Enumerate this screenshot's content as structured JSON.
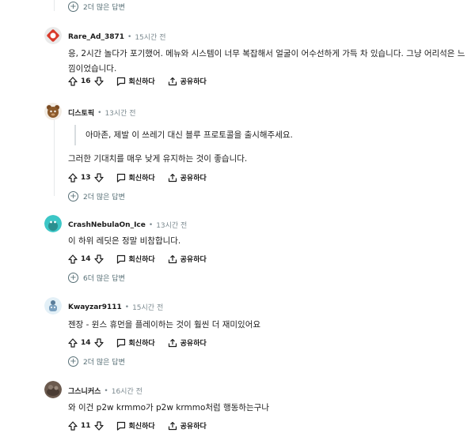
{
  "top_more": {
    "label": "2더 많은 답변"
  },
  "comments": [
    {
      "user": "Rare_Ad_3871",
      "time": "15시간 전",
      "text_lines": [
        "응, 2시간 놀다가 포기했어. 메뉴와 시스템이 너무 복잡해서 얼굴이 어수선하게 가득 차 있습니다. 그냥 어리석은 느",
        "낌이었습니다."
      ],
      "votes": "16",
      "reply_label": "회신하다",
      "share_label": "공유하다"
    },
    {
      "user": "디스토픽",
      "time": "13시간 전",
      "quote": "아마존, 제발 이 쓰레기 대신 블루 프로토콜을 출시해주세요.",
      "text": "그러한 기대치를 매우 낮게 유지하는 것이 좋습니다.",
      "votes": "13",
      "reply_label": "회신하다",
      "share_label": "공유하다",
      "more_label": "2더 많은 답변"
    },
    {
      "user": "CrashNebulaOn_Ice",
      "time": "13시간 전",
      "text": "이 하위 레딧은 정말 비참합니다.",
      "votes": "14",
      "reply_label": "회신하다",
      "share_label": "공유하다",
      "more_label": "6더 많은 답변"
    },
    {
      "user": "Kwayzar9111",
      "time": "15시간 전",
      "text": "젠장 - 윈스 휴먼을 플레이하는 것이 훨씬 더 재미있어요",
      "votes": "14",
      "reply_label": "회신하다",
      "share_label": "공유하다",
      "more_label": "2더 많은 답변"
    },
    {
      "user": "그스니커스",
      "time": "16시간 전",
      "text": "와 이건 p2w krmmo가 p2w krmmo처럼 행동하는구나",
      "votes": "11",
      "reply_label": "회신하다",
      "share_label": "공유하다"
    }
  ],
  "colors": {
    "meta": "#7c8a90",
    "line": "#e5e8ea",
    "text": "#1c1c1c"
  },
  "icons": [
    "upvote-icon",
    "downvote-icon",
    "reply-icon",
    "share-icon",
    "plus-circle-icon"
  ]
}
